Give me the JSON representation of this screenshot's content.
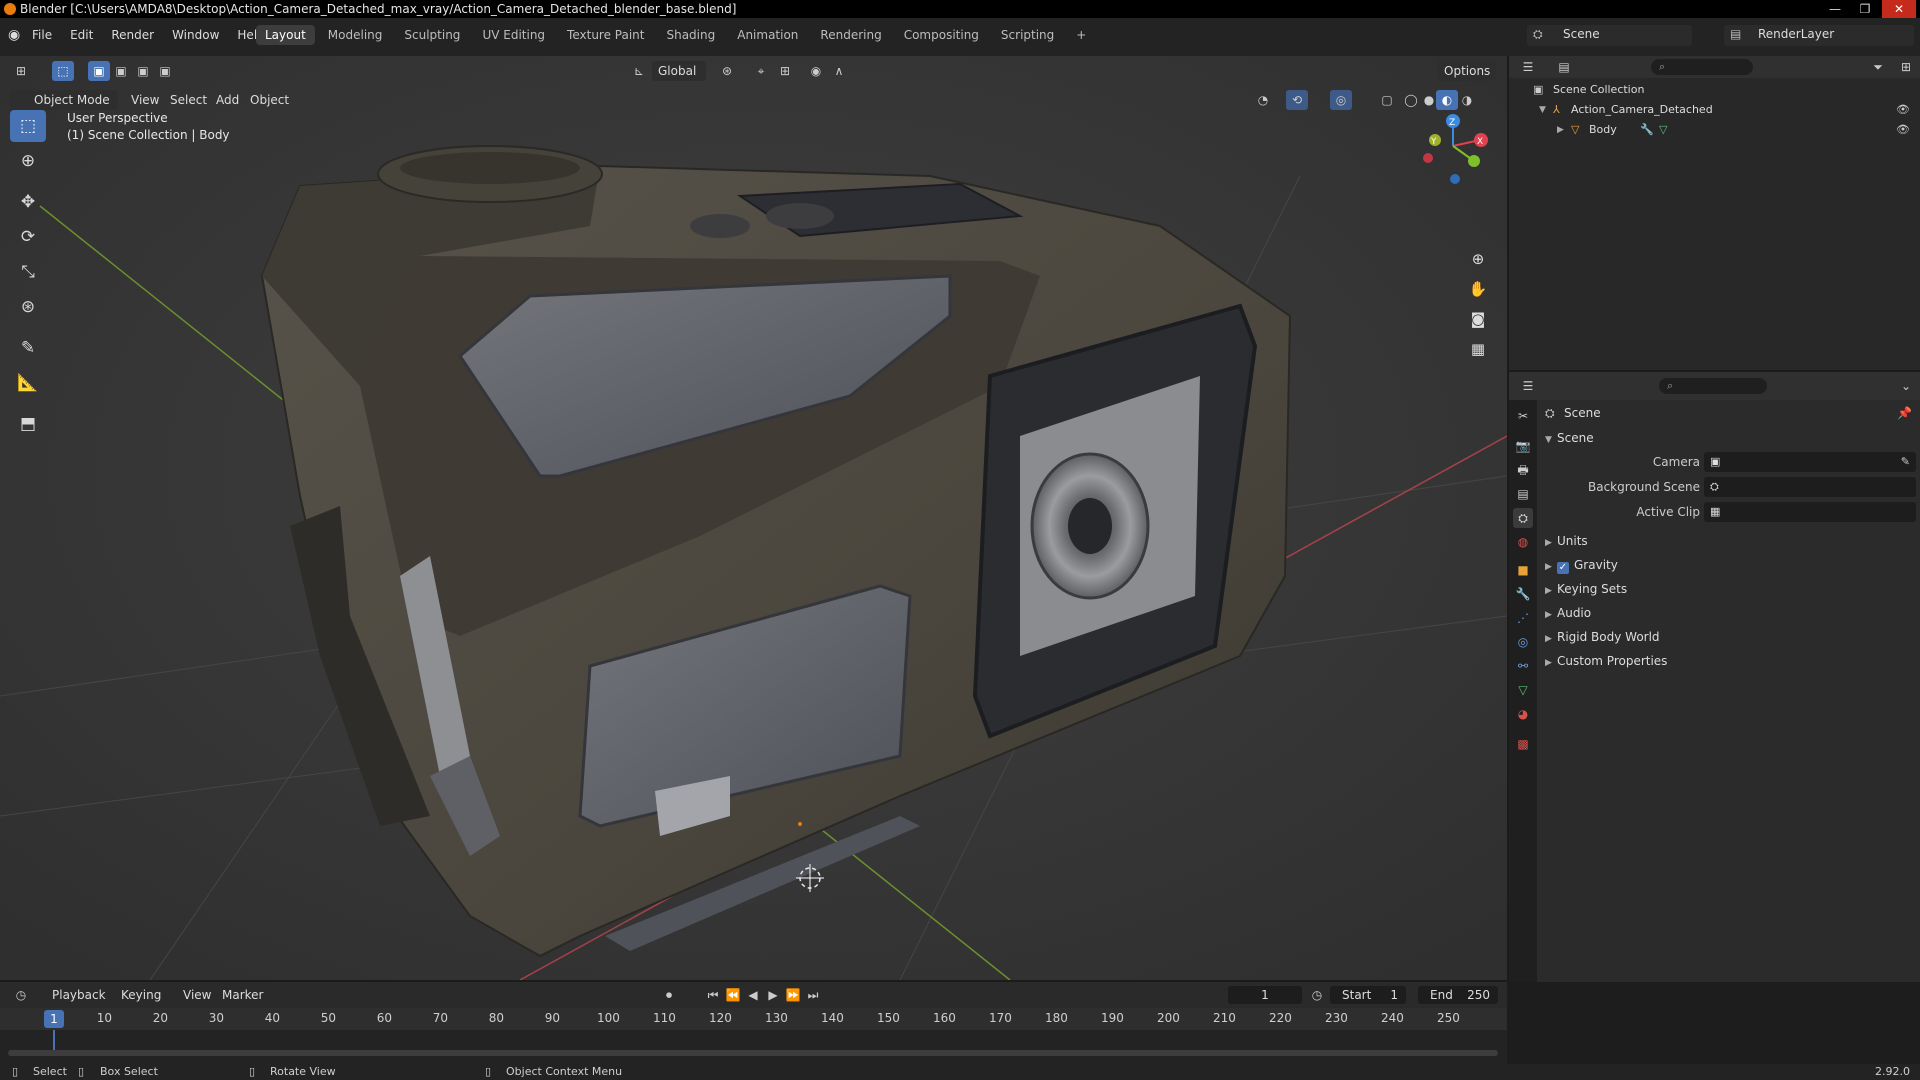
{
  "window": {
    "title": "Blender [C:\\Users\\AMDA8\\Desktop\\Action_Camera_Detached_max_vray/Action_Camera_Detached_blender_base.blend]",
    "controls": [
      "—",
      "❐",
      "✕"
    ]
  },
  "menubar": {
    "items": [
      "File",
      "Edit",
      "Render",
      "Window",
      "Help"
    ],
    "workspaces": [
      "Layout",
      "Modeling",
      "Sculpting",
      "UV Editing",
      "Texture Paint",
      "Shading",
      "Animation",
      "Rendering",
      "Compositing",
      "Scripting"
    ],
    "active_workspace": "Layout",
    "add_tab": "+",
    "scene": "Scene",
    "view_layer": "RenderLayer"
  },
  "viewport": {
    "mode": "Object Mode",
    "menus": [
      "View",
      "Select",
      "Add",
      "Object"
    ],
    "transform_orientation": "Global",
    "options": "Options",
    "perspective_label": "User Perspective",
    "collection_label": "(1) Scene Collection | Body",
    "gizmo_axes": {
      "x": "X",
      "y": "Y",
      "z": "Z"
    },
    "axis_colors": {
      "x": "#e0434f",
      "y": "#7fbf2a",
      "z": "#3b8be0"
    }
  },
  "outliner": {
    "search_placeholder": "⌕",
    "root": "Scene Collection",
    "items": [
      {
        "label": "Action_Camera_Detached"
      },
      {
        "label": "Body"
      }
    ]
  },
  "properties": {
    "search_placeholder": "⌕",
    "context_title": "Scene",
    "panel_title": "Scene",
    "fields": [
      {
        "label": "Camera"
      },
      {
        "label": "Background Scene"
      },
      {
        "label": "Active Clip"
      }
    ],
    "subpanels": [
      "Units",
      "Gravity",
      "Keying Sets",
      "Audio",
      "Rigid Body World",
      "Custom Properties"
    ],
    "gravity_checked": true
  },
  "timeline": {
    "menus": [
      "Playback",
      "Keying",
      "View",
      "Marker"
    ],
    "current_frame": "1",
    "start_label": "Start",
    "start": "1",
    "end_label": "End",
    "end": "250",
    "ticks": [
      "1",
      "10",
      "20",
      "30",
      "40",
      "50",
      "60",
      "70",
      "80",
      "90",
      "100",
      "110",
      "120",
      "130",
      "140",
      "150",
      "160",
      "170",
      "180",
      "190",
      "200",
      "210",
      "220",
      "230",
      "240",
      "250"
    ]
  },
  "statusbar": {
    "select": "Select",
    "box_select": "Box Select",
    "rotate_view": "Rotate View",
    "context_menu": "Object Context Menu",
    "version": "2.92.0"
  },
  "colors": {
    "accent": "#4772b3",
    "brand_orange": "#e87d0d"
  }
}
